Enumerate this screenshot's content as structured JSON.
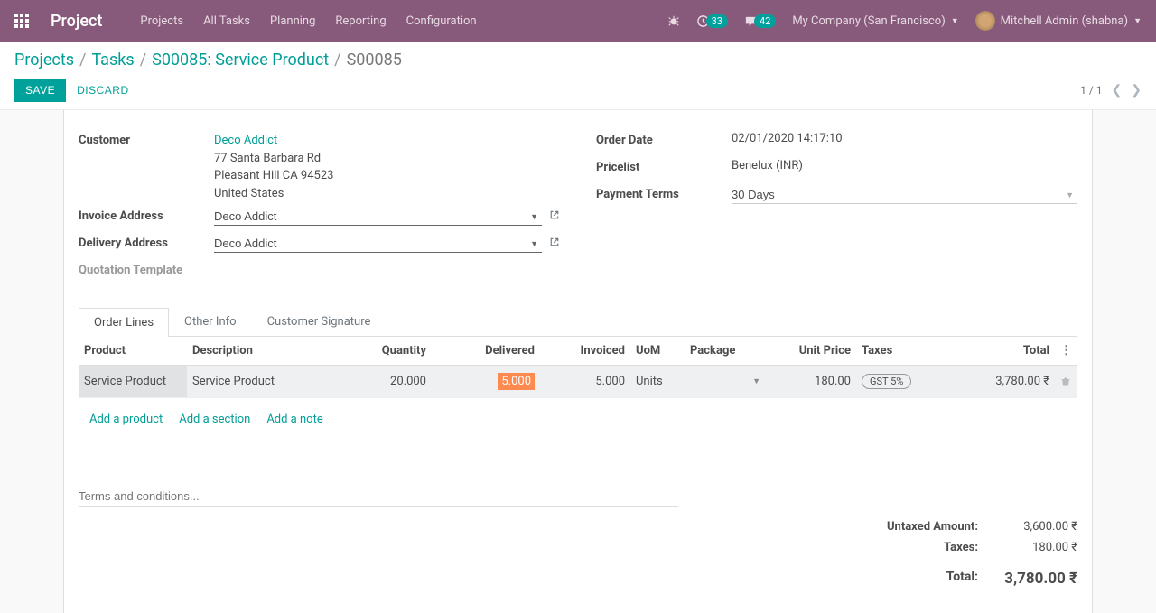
{
  "app": {
    "title": "Project"
  },
  "menu": {
    "projects": "Projects",
    "all_tasks": "All Tasks",
    "planning": "Planning",
    "reporting": "Reporting",
    "configuration": "Configuration"
  },
  "systray": {
    "activities_count": "33",
    "messages_count": "42",
    "company": "My Company (San Francisco)",
    "user": "Mitchell Admin (shabna)"
  },
  "breadcrumb": {
    "projects": "Projects",
    "tasks": "Tasks",
    "task": "S00085: Service Product",
    "current": "S00085"
  },
  "buttons": {
    "save": "SAVE",
    "discard": "DISCARD"
  },
  "pager": {
    "text": "1 / 1"
  },
  "labels": {
    "customer": "Customer",
    "invoice_address": "Invoice Address",
    "delivery_address": "Delivery Address",
    "quotation_template": "Quotation Template",
    "order_date": "Order Date",
    "pricelist": "Pricelist",
    "payment_terms": "Payment Terms"
  },
  "customer": {
    "name": "Deco Addict",
    "street": "77 Santa Barbara Rd",
    "city_line": "Pleasant Hill CA 94523",
    "country": "United States"
  },
  "fields": {
    "invoice_address": "Deco Addict",
    "delivery_address": "Deco Addict",
    "order_date": "02/01/2020 14:17:10",
    "pricelist": "Benelux (INR)",
    "payment_terms": "30 Days"
  },
  "tabs": {
    "order_lines": "Order Lines",
    "other_info": "Other Info",
    "customer_signature": "Customer Signature"
  },
  "table": {
    "headers": {
      "product": "Product",
      "description": "Description",
      "quantity": "Quantity",
      "delivered": "Delivered",
      "invoiced": "Invoiced",
      "uom": "UoM",
      "package": "Package",
      "unit_price": "Unit Price",
      "taxes": "Taxes",
      "total": "Total"
    },
    "rows": [
      {
        "product": "Service Product",
        "description": "Service Product",
        "quantity": "20.000",
        "delivered": "5.000",
        "invoiced": "5.000",
        "uom": "Units",
        "package": "",
        "unit_price": "180.00",
        "taxes": "GST 5%",
        "total": "3,780.00 ₹"
      }
    ],
    "add_product": "Add a product",
    "add_section": "Add a section",
    "add_note": "Add a note"
  },
  "terms_placeholder": "Terms and conditions...",
  "totals": {
    "untaxed_label": "Untaxed Amount:",
    "untaxed_value": "3,600.00 ₹",
    "taxes_label": "Taxes:",
    "taxes_value": "180.00 ₹",
    "total_label": "Total:",
    "total_value": "3,780.00 ₹"
  }
}
